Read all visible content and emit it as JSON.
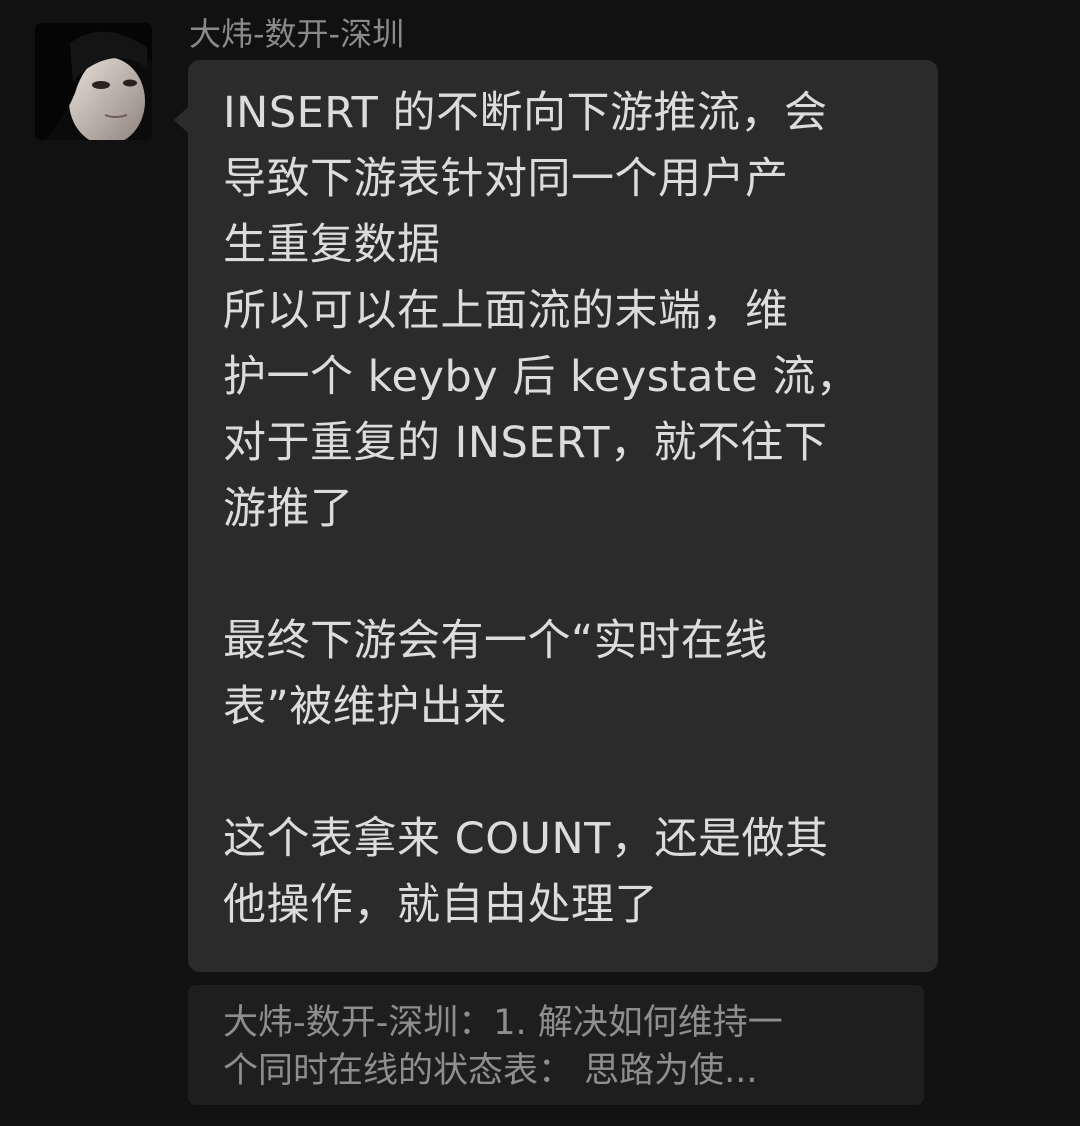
{
  "message": {
    "sender_name": "大炜-数开-深圳",
    "lines": [
      "INSERT 的不断向下游推流，会",
      "导致下游表针对同一个用户产",
      "生重复数据",
      "所以可以在上面流的末端，维",
      "护一个 keyby 后 keystate 流，",
      "对于重复的 INSERT，就不往下",
      "游推了",
      "",
      "最终下游会有一个“实时在线",
      "表”被维护出来",
      "",
      "这个表拿来 COUNT，还是做其",
      "他操作，就自由处理了"
    ]
  },
  "quote": {
    "lines": [
      "大炜-数开-深圳：1. 解决如何维持一",
      "个同时在线的状态表：      思路为使..."
    ]
  },
  "colors": {
    "background": "#111111",
    "bubble": "#2b2b2b",
    "quote_bg": "#1e1e1e",
    "message_text": "#dcdcdc",
    "secondary_text": "#8a8a8a"
  }
}
